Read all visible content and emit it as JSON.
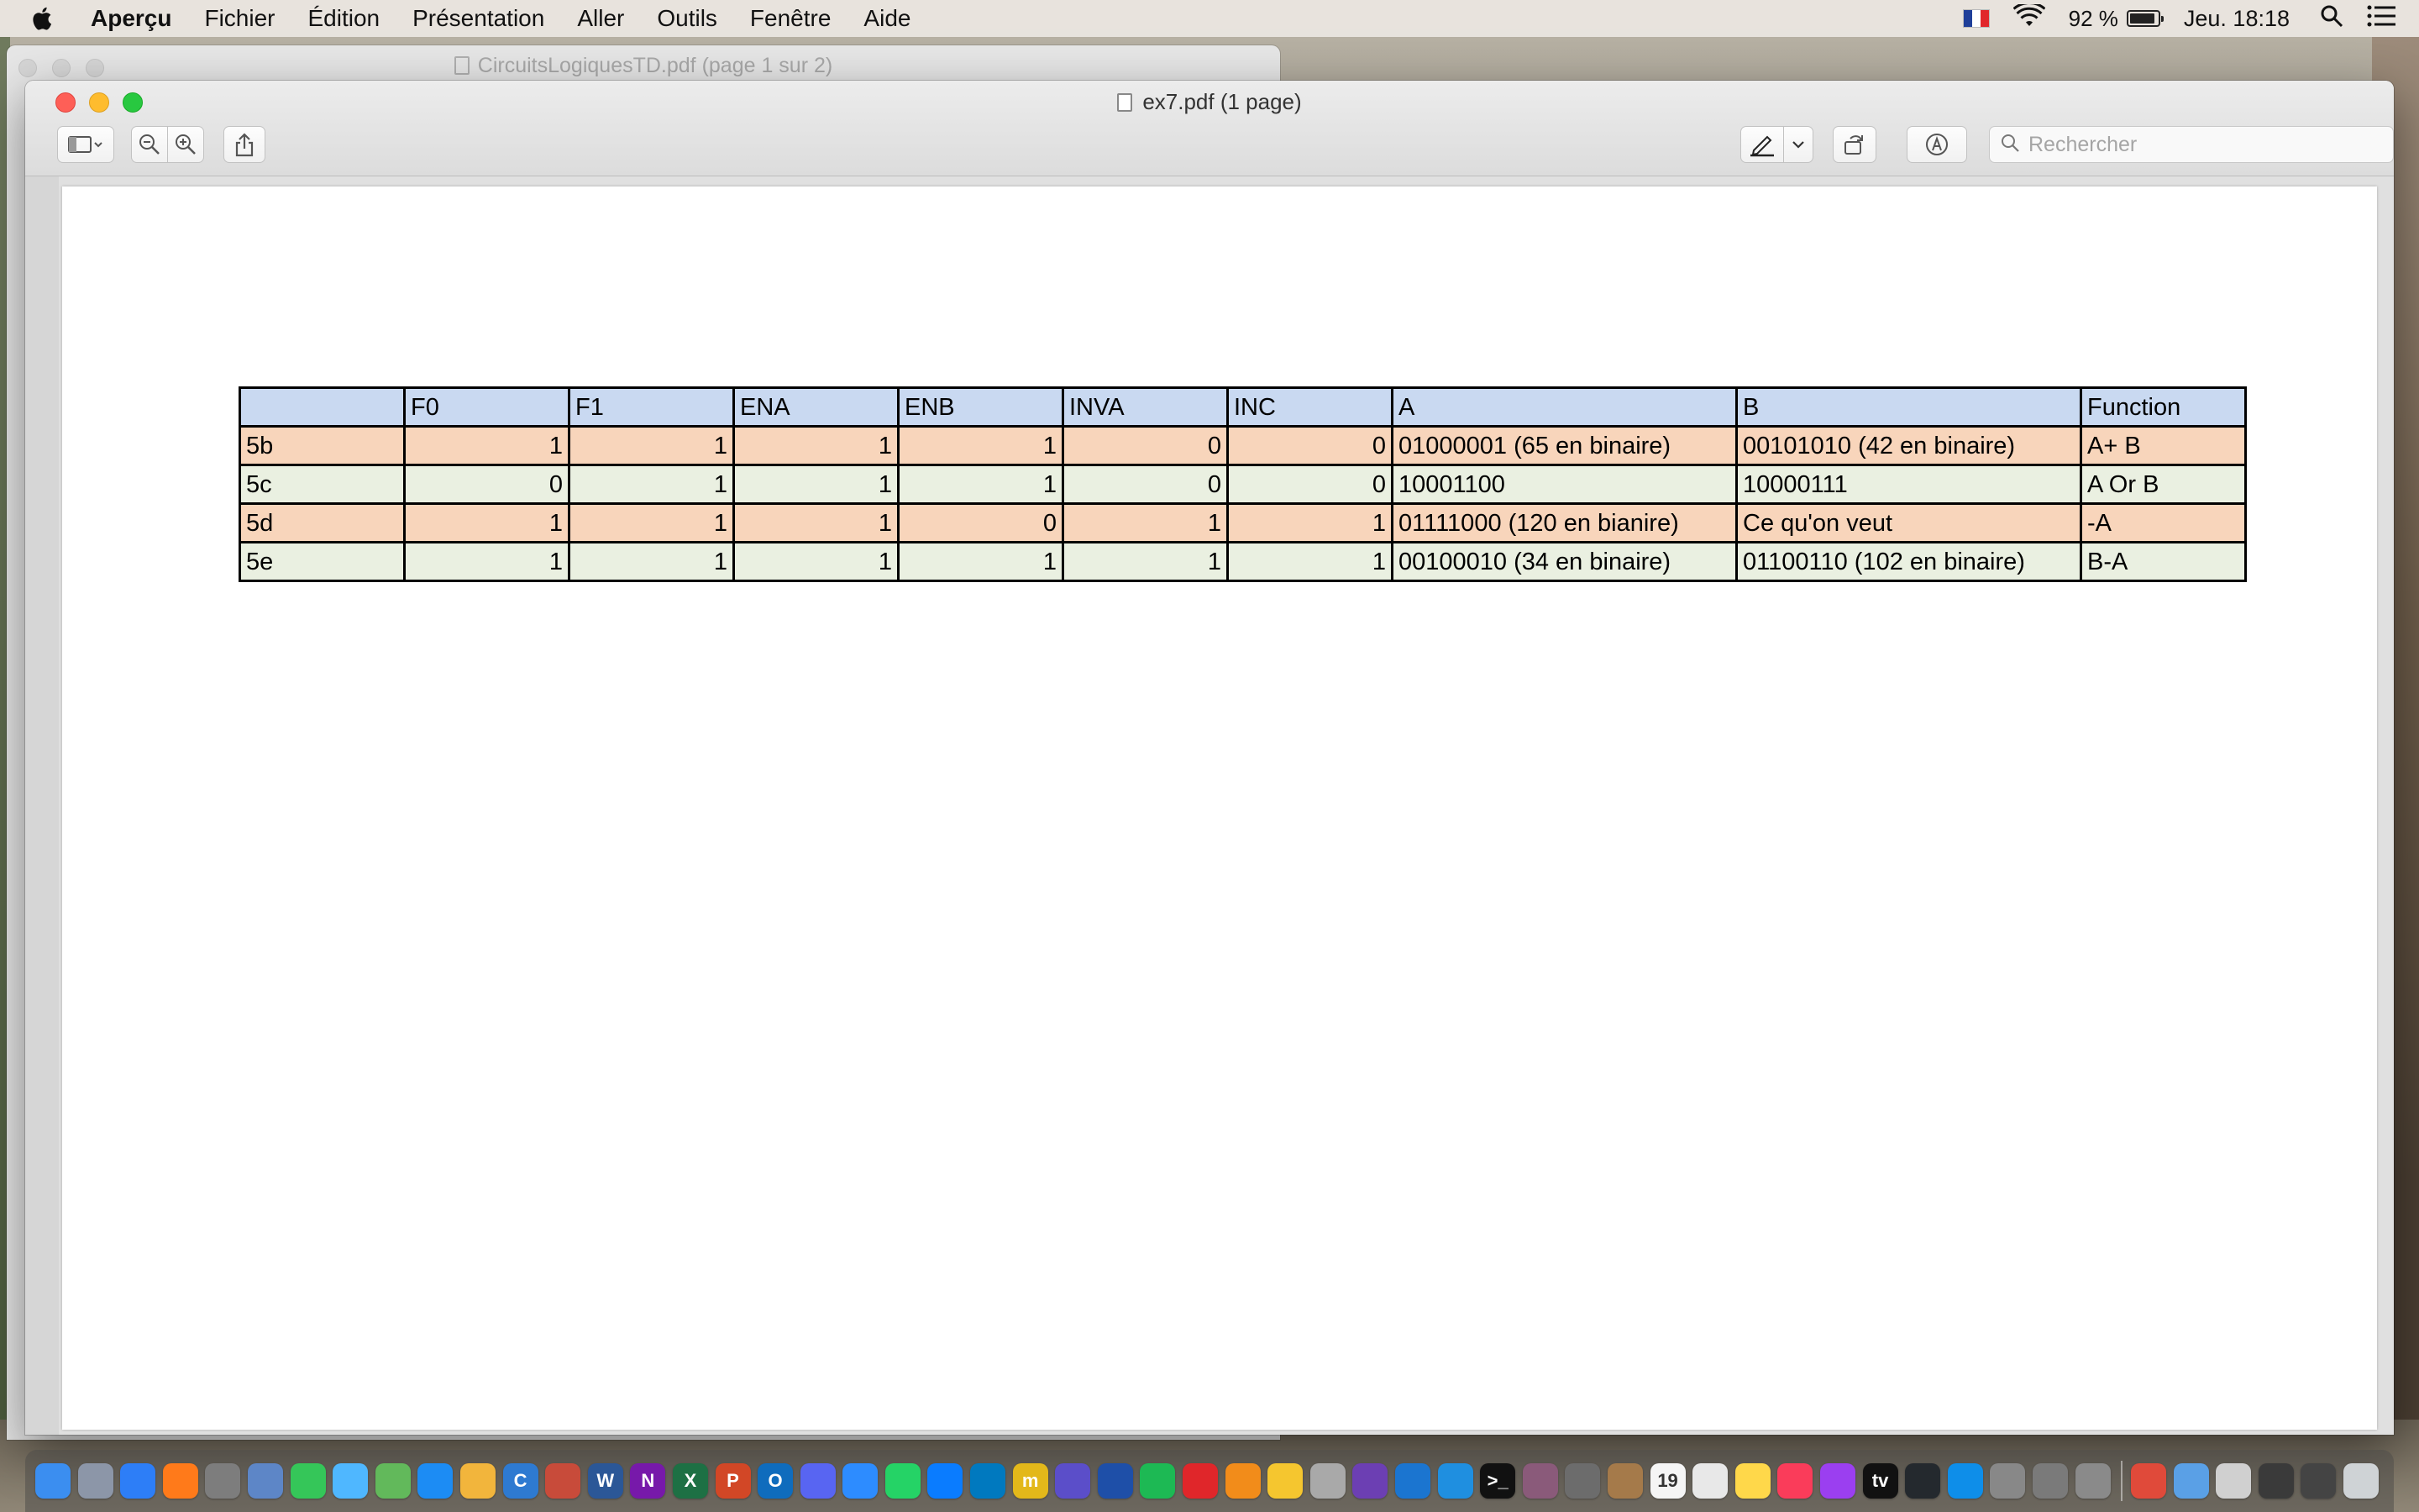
{
  "menubar": {
    "app_name": "Aperçu",
    "items": [
      "Fichier",
      "Édition",
      "Présentation",
      "Aller",
      "Outils",
      "Fenêtre",
      "Aide"
    ],
    "battery_percent": "92 %",
    "battery_level": 0.92,
    "clock": "Jeu. 18:18"
  },
  "background_window": {
    "title": "CircuitsLogiquesTD.pdf (page 1 sur 2)"
  },
  "window": {
    "title": "ex7.pdf (1 page)",
    "search_placeholder": "Rechercher"
  },
  "table": {
    "headers": [
      "",
      "F0",
      "F1",
      "ENA",
      "ENB",
      "INVA",
      "INC",
      "A",
      "B",
      "Function"
    ],
    "rows": [
      [
        "5b",
        "1",
        "1",
        "1",
        "1",
        "0",
        "0",
        "01000001 (65 en binaire)",
        "00101010 (42 en binaire)",
        "A+ B"
      ],
      [
        "5c",
        "0",
        "1",
        "1",
        "1",
        "0",
        "0",
        "10001100",
        "10000111",
        "A Or B"
      ],
      [
        "5d",
        "1",
        "1",
        "1",
        "0",
        "1",
        "1",
        "01111000 (120 en bianire)",
        "Ce qu'on veut",
        "-A"
      ],
      [
        "5e",
        "1",
        "1",
        "1",
        "1",
        "1",
        "1",
        "00100010 (34 en binaire)",
        "01100110 (102 en binaire)",
        "B-A"
      ]
    ]
  },
  "colors": {
    "header_row": "#c9d9f1",
    "odd_row": "#f8d5bb",
    "even_row": "#eaf0e1",
    "close": "#fe5f57",
    "minimize": "#febc2e",
    "maximize": "#28c840"
  },
  "dock": {
    "apps": [
      {
        "icon": "finder-icon",
        "color": "#3b8ef0",
        "glyph": ""
      },
      {
        "icon": "launchpad-icon",
        "color": "#8c96a8",
        "glyph": ""
      },
      {
        "icon": "safari-icon",
        "color": "#2d7ef7",
        "glyph": ""
      },
      {
        "icon": "firefox-icon",
        "color": "#ff7a1a",
        "glyph": ""
      },
      {
        "icon": "system-preferences-icon",
        "color": "#7d7d7d",
        "glyph": ""
      },
      {
        "icon": "preview-icon",
        "color": "#5d86c7",
        "glyph": ""
      },
      {
        "icon": "facetime-icon",
        "color": "#35c659",
        "glyph": ""
      },
      {
        "icon": "messages-icon",
        "color": "#4fb7ff",
        "glyph": ""
      },
      {
        "icon": "maps-icon",
        "color": "#62b95b",
        "glyph": ""
      },
      {
        "icon": "app-store-icon",
        "color": "#1c8cf4",
        "glyph": ""
      },
      {
        "icon": "photos-icon",
        "color": "#f2b53c",
        "glyph": ""
      },
      {
        "icon": "ccleaner-icon",
        "color": "#2e7ad1",
        "glyph": "C"
      },
      {
        "icon": "toolbox-icon",
        "color": "#c84b3a",
        "glyph": ""
      },
      {
        "icon": "word-icon",
        "color": "#2b5797",
        "glyph": "W"
      },
      {
        "icon": "onenote-icon",
        "color": "#7719aa",
        "glyph": "N"
      },
      {
        "icon": "excel-icon",
        "color": "#1d7044",
        "glyph": "X"
      },
      {
        "icon": "powerpoint-icon",
        "color": "#d24726",
        "glyph": "P"
      },
      {
        "icon": "outlook-icon",
        "color": "#0f6cbd",
        "glyph": "O"
      },
      {
        "icon": "discord-icon",
        "color": "#5865f2",
        "glyph": ""
      },
      {
        "icon": "zoom-icon",
        "color": "#2d8cff",
        "glyph": ""
      },
      {
        "icon": "whatsapp-icon",
        "color": "#25d366",
        "glyph": ""
      },
      {
        "icon": "messenger-icon",
        "color": "#0a7cff",
        "glyph": ""
      },
      {
        "icon": "trello-icon",
        "color": "#0079bf",
        "glyph": ""
      },
      {
        "icon": "mendeley-icon",
        "color": "#e3b81a",
        "glyph": "m"
      },
      {
        "icon": "imovie-icon",
        "color": "#5b4ec9",
        "glyph": ""
      },
      {
        "icon": "headphones-icon",
        "color": "#1e4fa8",
        "glyph": ""
      },
      {
        "icon": "spotify-icon",
        "color": "#1db954",
        "glyph": ""
      },
      {
        "icon": "antivirus-icon",
        "color": "#e0262a",
        "glyph": ""
      },
      {
        "icon": "vlc-icon",
        "color": "#f28c1a",
        "glyph": ""
      },
      {
        "icon": "star-app-icon",
        "color": "#f5c62f",
        "glyph": ""
      },
      {
        "icon": "tooth-app-icon",
        "color": "#a9a9a9",
        "glyph": ""
      },
      {
        "icon": "visual-studio-icon",
        "color": "#6c3fb3",
        "glyph": ""
      },
      {
        "icon": "xcode-icon",
        "color": "#1b75d0",
        "glyph": ""
      },
      {
        "icon": "vscode-icon",
        "color": "#1f8fe0",
        "glyph": ""
      },
      {
        "icon": "terminal-icon",
        "color": "#111111",
        "glyph": ">_"
      },
      {
        "icon": "disk-utility-icon",
        "color": "#8a5a7a",
        "glyph": ""
      },
      {
        "icon": "chess-icon",
        "color": "#6c6c6c",
        "glyph": ""
      },
      {
        "icon": "dictionary-icon",
        "color": "#a57a4a",
        "glyph": ""
      },
      {
        "icon": "calendar-icon",
        "color": "#f5f5f5",
        "glyph": "19"
      },
      {
        "icon": "reminders-icon",
        "color": "#e8e8e8",
        "glyph": ""
      },
      {
        "icon": "notes-icon",
        "color": "#ffd84a",
        "glyph": ""
      },
      {
        "icon": "music-icon",
        "color": "#fa3c5a",
        "glyph": ""
      },
      {
        "icon": "podcasts-icon",
        "color": "#9b3ff0",
        "glyph": ""
      },
      {
        "icon": "apple-tv-icon",
        "color": "#111111",
        "glyph": "tv"
      },
      {
        "icon": "github-icon",
        "color": "#24292e",
        "glyph": ""
      },
      {
        "icon": "teamviewer-icon",
        "color": "#0e8ee9",
        "glyph": ""
      },
      {
        "icon": "utility-icon",
        "color": "#888888",
        "glyph": ""
      },
      {
        "icon": "migration-icon",
        "color": "#7a7a7a",
        "glyph": ""
      },
      {
        "icon": "preferences-alt-icon",
        "color": "#8a8a8a",
        "glyph": ""
      }
    ],
    "trailing": [
      {
        "icon": "chrome-icon",
        "color": "#e04a3a",
        "glyph": ""
      },
      {
        "icon": "downloads-folder-icon",
        "color": "#5aa0e6",
        "glyph": ""
      },
      {
        "icon": "screenshot-icon",
        "color": "#d0d0d0",
        "glyph": ""
      },
      {
        "icon": "window-thumbnail-icon",
        "color": "#3a3a3a",
        "glyph": ""
      },
      {
        "icon": "window-thumbnail-icon",
        "color": "#444444",
        "glyph": ""
      },
      {
        "icon": "trash-icon",
        "color": "#cfd3d6",
        "glyph": ""
      }
    ]
  }
}
